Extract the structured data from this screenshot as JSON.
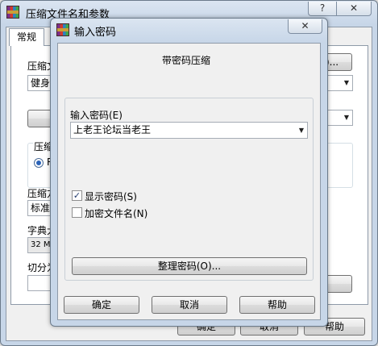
{
  "background_window": {
    "title": "压缩文件名和参数",
    "help_glyph": "?",
    "close_glyph": "✕",
    "tab_general": "常规",
    "archive_label_partial": "压缩文",
    "browse_button_partial": ")...",
    "profile_value_partial": "健身",
    "format_group_partial": "压缩",
    "format_radio_partial": "R",
    "method_label_partial": "压缩方",
    "method_value_partial": "标准",
    "dict_label_partial": "字典大",
    "dict_value_partial": "32 MB",
    "split_label_partial": "切分为",
    "ok_partial": "确定",
    "cancel_partial": "取消",
    "help_button": "帮助"
  },
  "dialog": {
    "title": "输入密码",
    "close_glyph": "✕",
    "heading": "带密码压缩",
    "password_label": "输入密码(E)",
    "password_value": "上老王论坛当老王",
    "show_password_label": "显示密码(S)",
    "show_password_checked": true,
    "encrypt_names_label": "加密文件名(N)",
    "encrypt_names_checked": false,
    "organize_button": "整理密码(O)...",
    "ok_button": "确定",
    "cancel_button": "取消",
    "help_button": "帮助"
  }
}
